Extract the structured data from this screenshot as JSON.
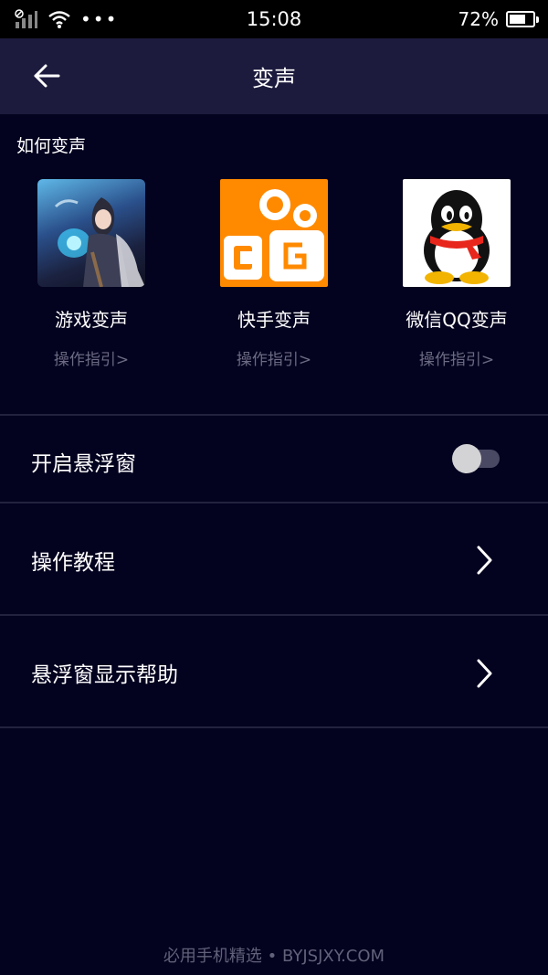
{
  "status_bar": {
    "time": "15:08",
    "battery_percent": "72%",
    "battery_level": 0.72,
    "icons": [
      "signal-icon",
      "wifi-icon",
      "more-dots-icon",
      "battery-icon"
    ],
    "dots": "•••"
  },
  "header": {
    "title": "变声",
    "back_icon": "arrow-left-icon"
  },
  "section": {
    "title": "如何变声",
    "apps": [
      {
        "name": "游戏变声",
        "guide": "操作指引>",
        "icon": "game-character-icon"
      },
      {
        "name": "快手变声",
        "guide": "操作指引>",
        "icon": "kuaishou-icon"
      },
      {
        "name": "微信QQ变声",
        "guide": "操作指引>",
        "icon": "qq-penguin-icon"
      }
    ]
  },
  "settings": {
    "floating_window": {
      "label": "开启悬浮窗",
      "enabled": false
    },
    "tutorial": {
      "label": "操作教程"
    },
    "float_help": {
      "label": "悬浮窗显示帮助"
    }
  },
  "footer": {
    "text": "必用手机精选 • BYJSJXY.COM"
  },
  "colors": {
    "background": "#03021f",
    "header": "#1c1b3d",
    "kuaishou_orange": "#ff8a00",
    "muted_text": "#6c6b83"
  }
}
